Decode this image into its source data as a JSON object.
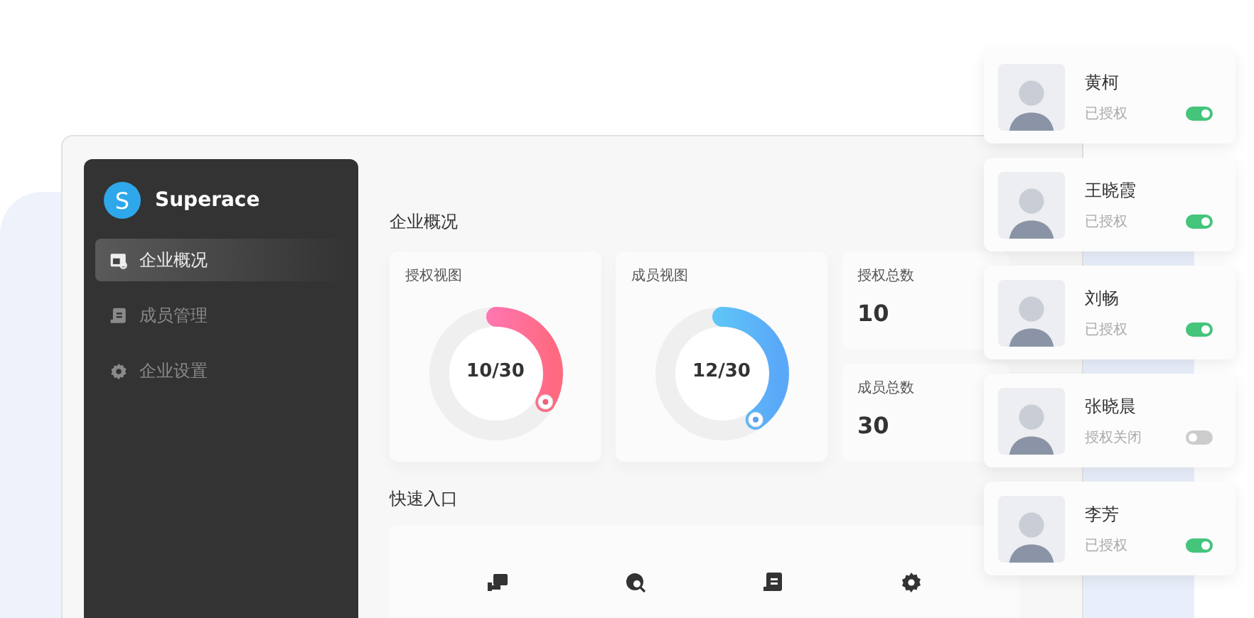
{
  "sidebar": {
    "brand_initial": "S",
    "brand": "Superace",
    "items": [
      {
        "label": "企业概况",
        "selected": true
      },
      {
        "label": "成员管理",
        "selected": false
      },
      {
        "label": "企业设置",
        "selected": false
      }
    ]
  },
  "overview": {
    "title": "企业概况",
    "donuts": [
      {
        "title": "授权视图",
        "reading": "10/30",
        "level": 0.333,
        "kind": "pink"
      },
      {
        "title": "成员视图",
        "reading": "12/30",
        "level": 0.4,
        "kind": "blue"
      }
    ],
    "stats": [
      {
        "label": "授权总数",
        "value": "10"
      },
      {
        "label": "成员总数",
        "value": "30"
      }
    ]
  },
  "quick_entry": {
    "title": "快速入口"
  },
  "members": [
    {
      "name": "黄柯",
      "status": "已授权",
      "on": true
    },
    {
      "name": "王晓霞",
      "status": "已授权",
      "on": true
    },
    {
      "name": "刘畅",
      "status": "已授权",
      "on": true
    },
    {
      "name": "张晓晨",
      "status": "授权关闭",
      "on": false
    },
    {
      "name": "李芳",
      "status": "已授权",
      "on": true
    }
  ]
}
